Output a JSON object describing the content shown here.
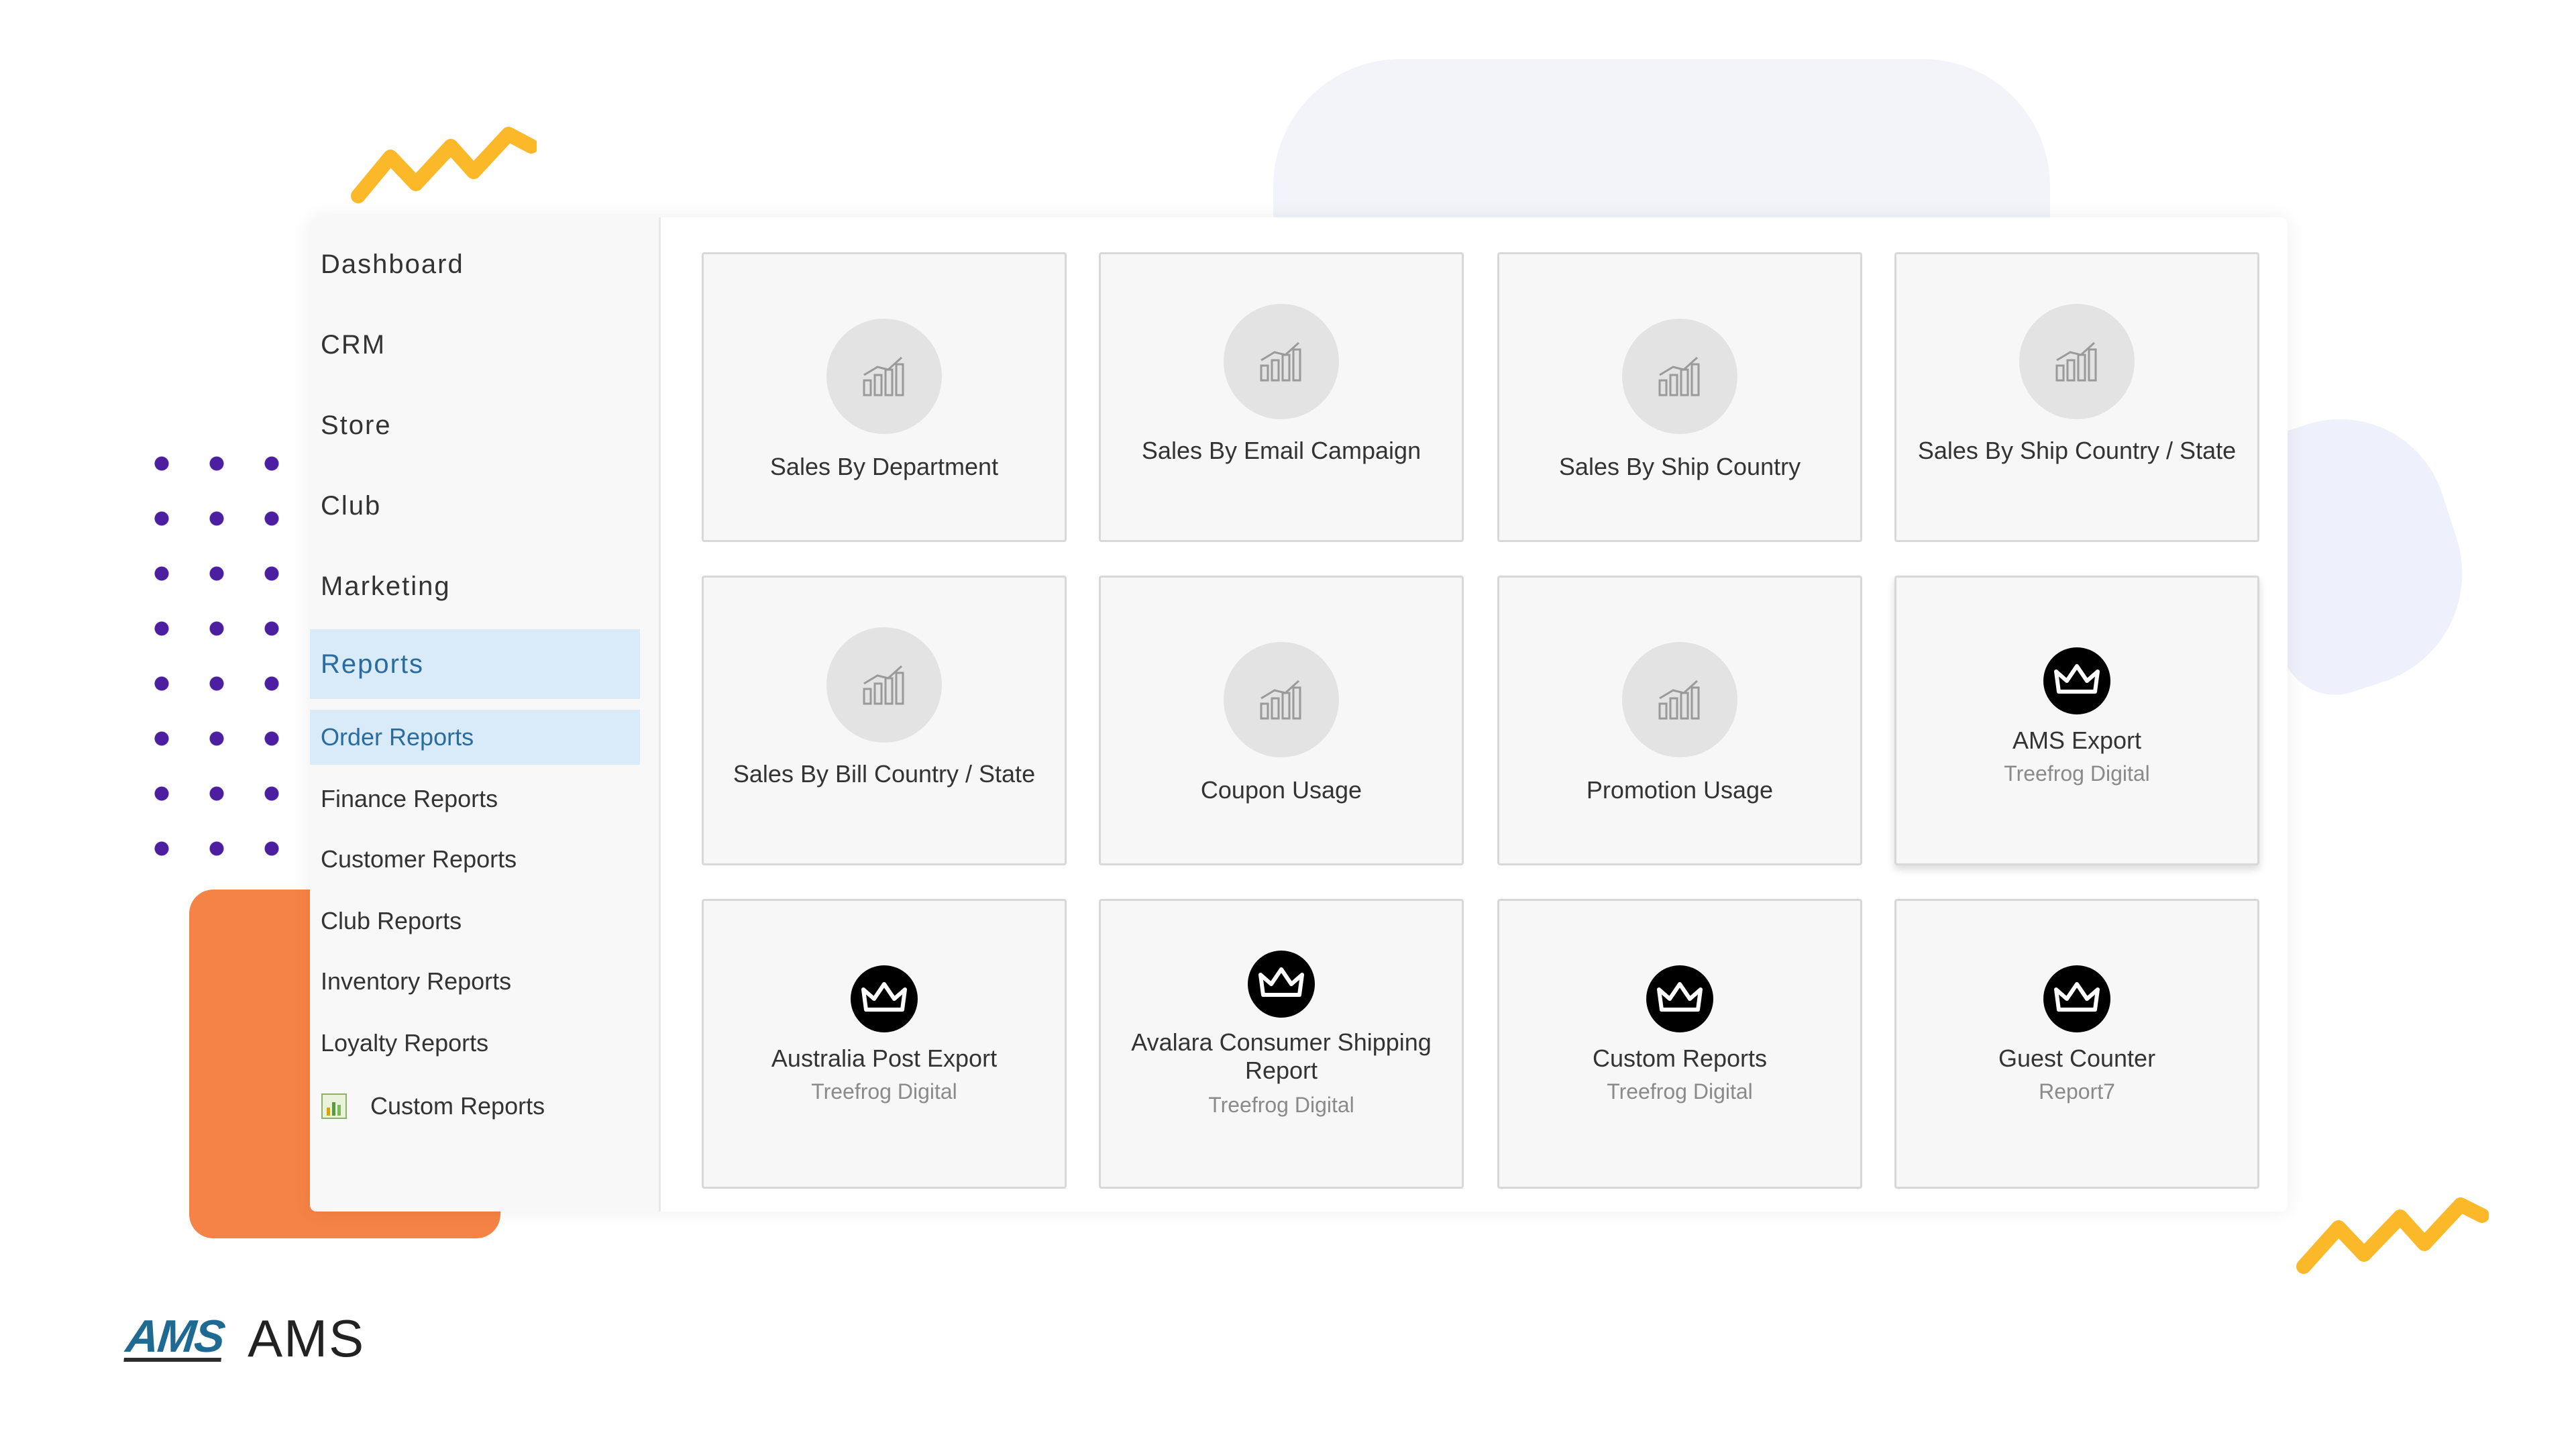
{
  "sidebar": {
    "items": [
      {
        "label": "Dashboard"
      },
      {
        "label": "CRM"
      },
      {
        "label": "Store"
      },
      {
        "label": "Club"
      },
      {
        "label": "Marketing"
      },
      {
        "label": "Reports",
        "active": true
      }
    ],
    "subitems": [
      {
        "label": "Order Reports",
        "active": true
      },
      {
        "label": "Finance Reports"
      },
      {
        "label": "Customer Reports"
      },
      {
        "label": "Club Reports"
      },
      {
        "label": "Inventory Reports"
      },
      {
        "label": "Loyalty Reports"
      },
      {
        "label": "Custom Reports",
        "icon": "spreadsheet-chart-icon"
      }
    ]
  },
  "tiles": [
    {
      "title": "Sales By Department",
      "icon": "chart-icon"
    },
    {
      "title": "Sales By Email Campaign",
      "icon": "chart-icon"
    },
    {
      "title": "Sales By Ship Country",
      "icon": "chart-icon"
    },
    {
      "title": "Sales By Ship Country / State",
      "icon": "chart-icon"
    },
    {
      "title": "Sales By Bill Country / State",
      "icon": "chart-icon"
    },
    {
      "title": "Coupon Usage",
      "icon": "chart-icon"
    },
    {
      "title": "Promotion Usage",
      "icon": "chart-icon"
    },
    {
      "title": "AMS Export",
      "subtitle": "Treefrog Digital",
      "icon": "crown-icon"
    },
    {
      "title": "Australia Post Export",
      "subtitle": "Treefrog Digital",
      "icon": "crown-icon"
    },
    {
      "title": "Avalara Consumer Shipping Report",
      "subtitle": "Treefrog Digital",
      "icon": "crown-icon"
    },
    {
      "title": "Custom Reports",
      "subtitle": "Treefrog Digital",
      "icon": "crown-icon"
    },
    {
      "title": "Guest Counter",
      "subtitle": "Report7",
      "icon": "crown-icon"
    }
  ],
  "brand": {
    "logo_text": "AMS",
    "name": "AMS"
  },
  "colors": {
    "accent_orange": "#f58345",
    "accent_yellow": "#fbb829",
    "dots_purple": "#4b1fa0",
    "active_bg": "#d9eaf8",
    "active_text": "#2a6c9e"
  }
}
